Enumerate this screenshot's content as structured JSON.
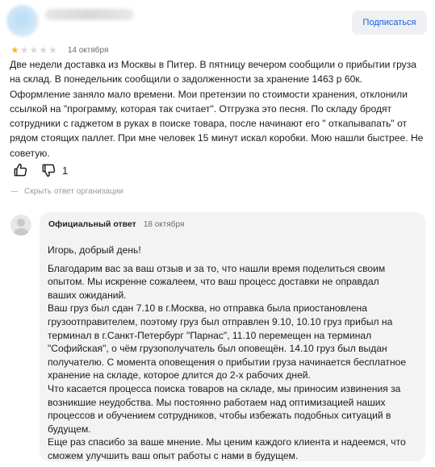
{
  "header": {
    "subscribe_label": "Подписаться"
  },
  "review": {
    "rating": 1,
    "rating_max": 5,
    "date": "14 октября",
    "text": "Две недели доставка из Москвы в Питер. В пятницу вечером сообщили о прибытии груза на склад. В понедельник сообщили о задолженности за хранение 1463 р 60к. Оформление заняло мало времени. Мои претензии по стоимости хранения, отклонили ссылкой на \"программу, которая так считает\". Отгрузка это песня. По складу бродят сотрудники с гаджетом в руках в поиске товара, после начинают его \" откапывапать\" от рядом стоящих паллет. При мне человек 15 минут искал коробки. Мою нашли быстрее. Не советую.",
    "dislike_count": "1",
    "hide_reply_label": "Скрыть ответ организации"
  },
  "reply": {
    "label": "Официальный ответ",
    "date": "18 октября",
    "greeting": "Игорь, добрый день!",
    "paragraphs": [
      "Благодарим вас за ваш отзыв и за то, что нашли время поделиться своим опытом. Мы искренне сожалеем, что ваш процесс доставки не оправдал ваших ожиданий.",
      "Ваш груз был сдан 7.10 в г.Москва, но отправка была приостановлена грузоотправителем, поэтому груз был отправлен 9.10, 10.10 груз прибыл на терминал в г.Санкт-Петербург \"Парнас\", 11.10 перемещен на терминал \"Софийская\", о чём грузополучатель был оповещён. 14.10 груз был выдан получателю. С момента оповещения о прибытии груза начинается бесплатное хранение на складе, которое длится до 2-х рабочих дней.",
      "Что касается процесса поиска товаров на складе, мы приносим извинения за возникшие неудобства. Мы постоянно работаем над оптимизацией наших процессов и обучением сотрудников, чтобы избежать подобных ситуаций в будущем.",
      "Еще раз спасибо за ваше мнение. Мы ценим каждого клиента и надеемся, что сможем улучшить ваш опыт работы с нами в будущем."
    ]
  },
  "colors": {
    "star_filled": "#f6bd1d",
    "star_empty": "#d7d7d7",
    "link_blue": "#1a5fd8"
  }
}
